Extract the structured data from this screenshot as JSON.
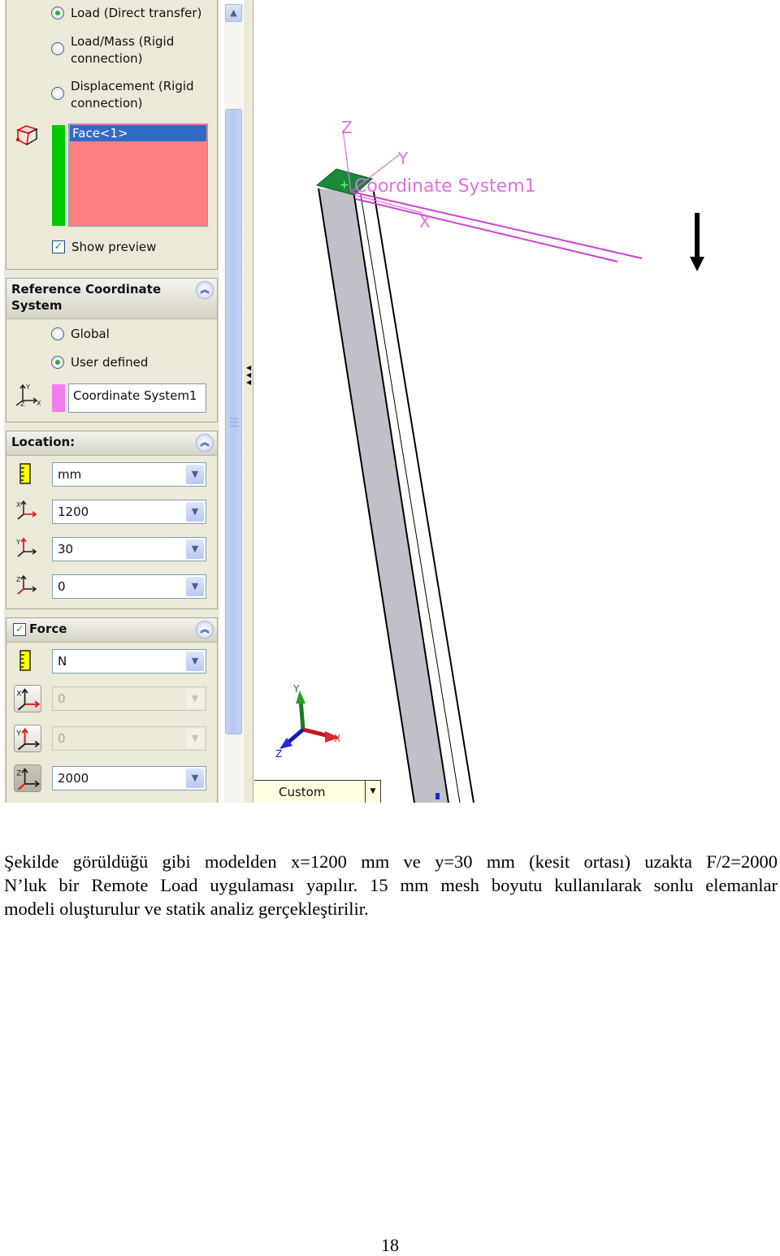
{
  "property_manager": {
    "connection_options": [
      {
        "label": "Load (Direct transfer)",
        "selected": true
      },
      {
        "label_line1": "Load/Mass (Rigid",
        "label_line2": "connection)",
        "selected": false
      },
      {
        "label_line1": "Displacement (Rigid",
        "label_line2": "connection)",
        "selected": false
      }
    ],
    "faces_list": {
      "items": [
        "Face<1>"
      ],
      "selected_color": "#316ac5",
      "list_color": "#ff8080"
    },
    "show_preview": {
      "label": "Show preview",
      "checked": true
    },
    "reference_coordinate_system": {
      "title_line1": "Reference Coordinate",
      "title_line2": "System",
      "options": [
        {
          "label": "Global",
          "selected": false
        },
        {
          "label": "User defined",
          "selected": true
        }
      ],
      "coordinate_system_field": "Coordinate System1"
    },
    "location": {
      "title": "Location:",
      "unit": "mm",
      "x": "1200",
      "y": "30",
      "z": "0"
    },
    "force": {
      "title": "Force",
      "enabled": true,
      "unit": "N",
      "x": "0",
      "y": "0",
      "z": "2000",
      "x_enabled": false,
      "y_enabled": false,
      "z_enabled": true
    }
  },
  "viewport": {
    "coordinate_system_label": "Coordinate System1",
    "axis_labels": {
      "x": "X",
      "y": "Y",
      "z": "Z"
    },
    "triad_labels": {
      "x": "X",
      "y": "Y",
      "z": "Z"
    },
    "view_orientation": "Custom",
    "colors": {
      "coordinate_system": "#e070e0",
      "selected_face": "#1a8a3a",
      "beam": "#c0c0c8"
    }
  },
  "document": {
    "paragraph_lines": [
      "Şekilde görüldüğü gibi modelden x=1200 mm ve y=30 mm (kesit ortası) uzakta F/2=2000",
      "N’luk bir Remote Load uygulaması yapılır. 15 mm mesh boyutu kullanılarak sonlu elemanlar",
      "modeli oluşturulur ve statik analiz gerçekleştirilir."
    ],
    "page_number": "18"
  }
}
